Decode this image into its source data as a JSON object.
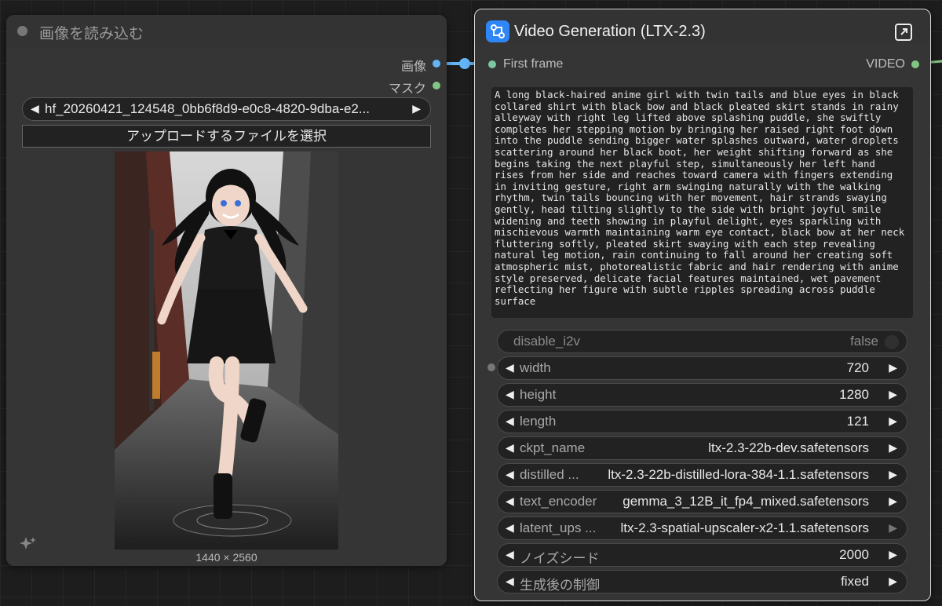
{
  "left_node": {
    "title": "画像を読み込む",
    "outputs": [
      {
        "label": "画像",
        "color": "#64b5f6"
      },
      {
        "label": "マスク",
        "color": "#81c784"
      }
    ],
    "image_file": "hf_20260421_124548_0bb6f8d9-e0c8-4820-9dba-e2...",
    "upload_button": "アップロードするファイルを選択",
    "image_size": "1440 × 2560",
    "image_alt": "anime girl with black twin tails splashing in rainy alley puddle",
    "sparkle_icon": "sparkle-icon"
  },
  "right_node": {
    "title": "Video Generation (LTX-2.3)",
    "header_icon": "workflow-icon",
    "expand_icon": "expand-icon",
    "input_label": "First frame",
    "output_label": "VIDEO",
    "prompt": "A long black-haired anime girl with twin tails and blue eyes in black collared shirt with black bow and black pleated skirt stands in rainy alleyway with right leg lifted above splashing puddle, she swiftly completes her stepping motion by bringing her raised right foot down into the puddle sending bigger water splashes outward, water droplets scattering around her black boot, her weight shifting forward as she begins taking the next playful step, simultaneously her left hand rises from her side and reaches toward camera with fingers extending in inviting gesture, right arm swinging naturally with the walking rhythm, twin tails bouncing with her movement, hair strands swaying gently, head tilting slightly to the side with bright joyful smile widening and teeth showing in playful delight, eyes sparkling with mischievous warmth maintaining warm eye contact, black bow at her neck fluttering softly, pleated skirt swaying with each step revealing natural leg motion, rain continuing to fall around her creating soft atmospheric mist, photorealistic fabric and hair rendering with anime style preserved, delicate facial features maintained, wet pavement reflecting her figure with subtle ripples spreading across puddle surface",
    "disable_i2v": {
      "name": "disable_i2v",
      "value": "false"
    },
    "widgets": [
      {
        "name": "width",
        "value": "720"
      },
      {
        "name": "height",
        "value": "1280"
      },
      {
        "name": "length",
        "value": "121"
      },
      {
        "name": "ckpt_name",
        "value": "ltx-2.3-22b-dev.safetensors"
      },
      {
        "name": "distilled ...",
        "value": "ltx-2.3-22b-distilled-lora-384-1.1.safetensors"
      },
      {
        "name": "text_encoder",
        "value": "gemma_3_12B_it_fp4_mixed.safetensors"
      },
      {
        "name": "latent_ups ...",
        "value": "ltx-2.3-spatial-upscaler-x2-1.1.safetensors"
      },
      {
        "name": "ノイズシード",
        "value": "2000"
      },
      {
        "name": "生成後の制御",
        "value": "fixed"
      }
    ]
  },
  "colors": {
    "image_link": "#64b5f6",
    "video_link": "#81c784",
    "accent_icon": "#2f86f6"
  }
}
